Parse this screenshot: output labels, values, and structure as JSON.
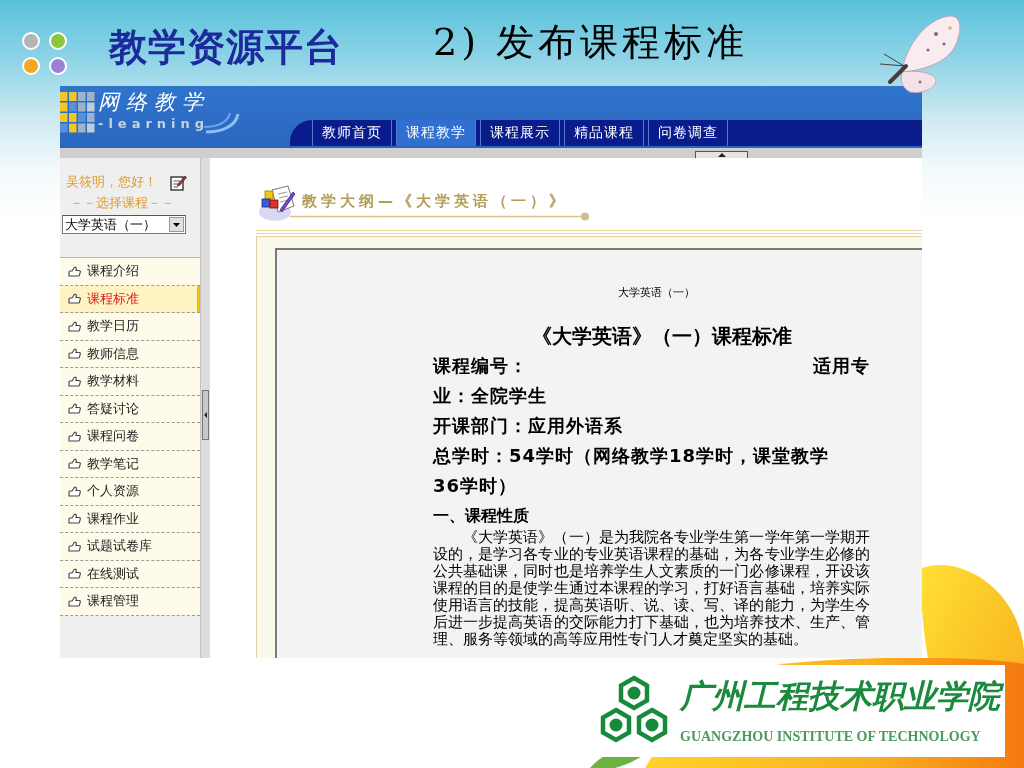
{
  "slide": {
    "title": "教学资源平台",
    "subtitle": "2) 发布课程标准"
  },
  "portal": {
    "logo": {
      "title": "网络教学",
      "subtitle": "-learning"
    },
    "tabs": [
      {
        "label": "教师首页",
        "selected": false
      },
      {
        "label": "课程教学",
        "selected": true
      },
      {
        "label": "课程展示",
        "selected": false
      },
      {
        "label": "精品课程",
        "selected": false
      },
      {
        "label": "问卷调查",
        "selected": false
      }
    ],
    "sidebar": {
      "greeting": "吴筱明，您好！",
      "course_prompt": "－－选择课程－－",
      "course_select": {
        "value": "大学英语（一）"
      },
      "menu": [
        {
          "label": "课程介绍",
          "selected": false
        },
        {
          "label": "课程标准",
          "selected": true
        },
        {
          "label": "教学日历",
          "selected": false
        },
        {
          "label": "教师信息",
          "selected": false
        },
        {
          "label": "教学材料",
          "selected": false
        },
        {
          "label": "答疑讨论",
          "selected": false
        },
        {
          "label": "课程问卷",
          "selected": false
        },
        {
          "label": "教学笔记",
          "selected": false
        },
        {
          "label": "个人资源",
          "selected": false
        },
        {
          "label": "课程作业",
          "selected": false
        },
        {
          "label": "试题试卷库",
          "selected": false
        },
        {
          "label": "在线测试",
          "selected": false
        },
        {
          "label": "课程管理",
          "selected": false
        }
      ]
    },
    "content": {
      "heading": "教学大纲—《大学英语（一）》",
      "document": {
        "running_header": "大学英语（一）",
        "title": "《大学英语》（一）课程标准",
        "lines": [
          {
            "kind": "split",
            "left": "课程编号：",
            "right": "适用专"
          },
          {
            "kind": "line",
            "text": "业：全院学生"
          },
          {
            "kind": "line",
            "text": "开课部门：应用外语系"
          },
          {
            "kind": "line",
            "text": "总学时：54学时（网络教学18学时，课堂教学"
          },
          {
            "kind": "line",
            "text": "36学时）"
          }
        ],
        "section_heading": "一、课程性质",
        "paragraph": "《大学英语》（一）是为我院各专业学生第一学年第一学期开设的，是学习各专业的专业英语课程的基础，为各专业学生必修的公共基础课，同时也是培养学生人文素质的一门必修课程，开设该课程的目的是使学生通过本课程的学习，打好语言基础，培养实际使用语言的技能，提高英语听、说、读、写、译的能力，为学生今后进一步提高英语的交际能力打下基础，也为培养技术、生产、管理、服务等领域的高等应用性专门人才奠定坚实的基础。"
      }
    }
  },
  "college_logo": {
    "name": "广州工程技术职业学院",
    "name_en": "GUANGZHOU INSTITUTE OF TECHNOLOGY"
  }
}
